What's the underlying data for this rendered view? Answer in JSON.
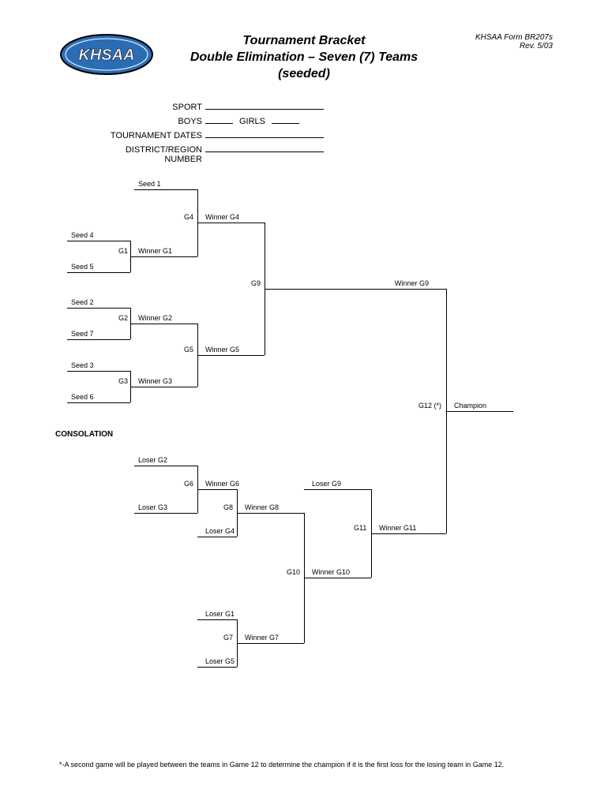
{
  "header": {
    "title1": "Tournament Bracket",
    "title2": "Double Elimination – Seven (7) Teams",
    "title3": "(seeded)",
    "form_id": "KHSAA Form BR207s",
    "rev": "Rev. 5/03"
  },
  "fields": {
    "sport": "SPORT",
    "boys": "BOYS",
    "girls": "GIRLS",
    "dates": "TOURNAMENT DATES",
    "district": "DISTRICT/REGION NUMBER"
  },
  "labels": {
    "seed1": "Seed 1",
    "seed2": "Seed 2",
    "seed3": "Seed 3",
    "seed4": "Seed 4",
    "seed5": "Seed 5",
    "seed6": "Seed 6",
    "seed7": "Seed 7",
    "g1": "G1",
    "g2": "G2",
    "g3": "G3",
    "g4": "G4",
    "g5": "G5",
    "g6": "G6",
    "g7": "G7",
    "g8": "G8",
    "g9": "G9",
    "g10": "G10",
    "g11": "G11",
    "g12": "G12  (*)",
    "wg1": "Winner G1",
    "wg2": "Winner G2",
    "wg3": "Winner G3",
    "wg4": "Winner G4",
    "wg5": "Winner G5",
    "wg6": "Winner G6",
    "wg7": "Winner G7",
    "wg8": "Winner G8",
    "wg9": "Winner G9",
    "wg10": "Winner G10",
    "wg11": "Winner G11",
    "lg1": "Loser G1",
    "lg2": "Loser G2",
    "lg3": "Loser G3",
    "lg4": "Loser G4",
    "lg5": "Loser G5",
    "lg9": "Loser G9",
    "champion": "Champion",
    "consolation": "CONSOLATION"
  },
  "footnote": "*-A second game will be played between the teams in Game 12 to determine the champion if it is the first loss for the losing team in Game 12."
}
